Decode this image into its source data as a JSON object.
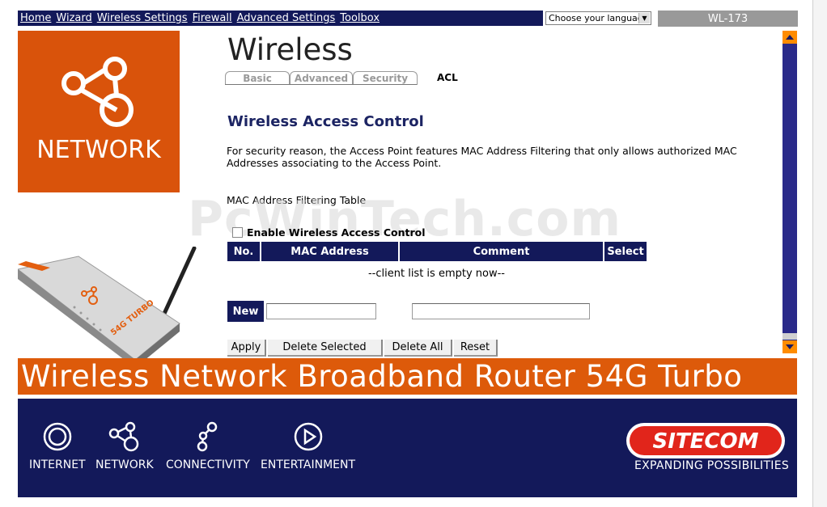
{
  "nav": {
    "links": [
      "Home",
      "Wizard",
      "Wireless Settings",
      "Firewall",
      "Advanced Settings",
      "Toolbox"
    ]
  },
  "language": {
    "selected": "Choose your language"
  },
  "model": "WL-173",
  "logo": {
    "label": "NETWORK",
    "color": "#d9530b"
  },
  "page": {
    "title": "Wireless",
    "tabs": [
      "Basic",
      "Advanced",
      "Security",
      "ACL"
    ],
    "active_tab": "ACL"
  },
  "acl": {
    "heading": "Wireless Access Control",
    "description": "For security reason, the Access Point features MAC Address Filtering that only allows authorized MAC Addresses associating to the Access Point.",
    "table_label": "MAC Address Filtering Table",
    "enable_label": "Enable Wireless Access Control",
    "enable_checked": false,
    "columns": [
      "No.",
      "MAC Address",
      "Comment",
      "Select"
    ],
    "empty_message": "--client list is empty now--",
    "new_label": "New",
    "new_mac_value": "",
    "new_comment_value": "",
    "buttons": {
      "apply": "Apply",
      "delete_selected": "Delete Selected",
      "delete_all": "Delete All",
      "reset": "Reset"
    }
  },
  "watermark": "PcWinTech.com",
  "router_label": "54G TURBO",
  "banner": "Wireless Network Broadband Router 54G Turbo",
  "footer": {
    "items": [
      "INTERNET",
      "NETWORK",
      "CONNECTIVITY",
      "ENTERTAINMENT"
    ],
    "brand": "SITECOM",
    "tagline": "EXPANDING POSSIBILITIES"
  },
  "colors": {
    "navy": "#13195a",
    "orange": "#dd5a0a",
    "scroll_arrow": "#ff8c00"
  }
}
